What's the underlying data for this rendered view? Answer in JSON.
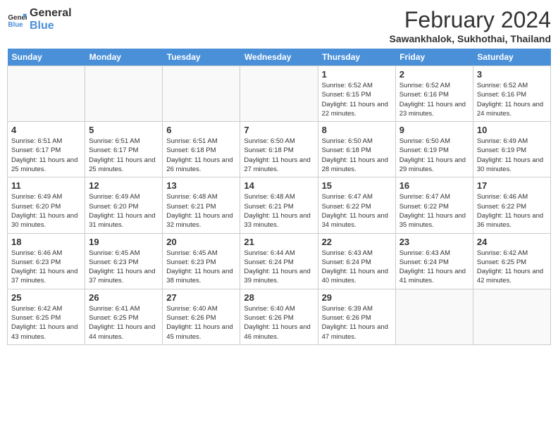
{
  "header": {
    "logo_line1": "General",
    "logo_line2": "Blue",
    "month_year": "February 2024",
    "location": "Sawankhalok, Sukhothai, Thailand"
  },
  "weekdays": [
    "Sunday",
    "Monday",
    "Tuesday",
    "Wednesday",
    "Thursday",
    "Friday",
    "Saturday"
  ],
  "weeks": [
    [
      {
        "day": "",
        "info": ""
      },
      {
        "day": "",
        "info": ""
      },
      {
        "day": "",
        "info": ""
      },
      {
        "day": "",
        "info": ""
      },
      {
        "day": "1",
        "info": "Sunrise: 6:52 AM\nSunset: 6:15 PM\nDaylight: 11 hours and 22 minutes."
      },
      {
        "day": "2",
        "info": "Sunrise: 6:52 AM\nSunset: 6:16 PM\nDaylight: 11 hours and 23 minutes."
      },
      {
        "day": "3",
        "info": "Sunrise: 6:52 AM\nSunset: 6:16 PM\nDaylight: 11 hours and 24 minutes."
      }
    ],
    [
      {
        "day": "4",
        "info": "Sunrise: 6:51 AM\nSunset: 6:17 PM\nDaylight: 11 hours and 25 minutes."
      },
      {
        "day": "5",
        "info": "Sunrise: 6:51 AM\nSunset: 6:17 PM\nDaylight: 11 hours and 25 minutes."
      },
      {
        "day": "6",
        "info": "Sunrise: 6:51 AM\nSunset: 6:18 PM\nDaylight: 11 hours and 26 minutes."
      },
      {
        "day": "7",
        "info": "Sunrise: 6:50 AM\nSunset: 6:18 PM\nDaylight: 11 hours and 27 minutes."
      },
      {
        "day": "8",
        "info": "Sunrise: 6:50 AM\nSunset: 6:18 PM\nDaylight: 11 hours and 28 minutes."
      },
      {
        "day": "9",
        "info": "Sunrise: 6:50 AM\nSunset: 6:19 PM\nDaylight: 11 hours and 29 minutes."
      },
      {
        "day": "10",
        "info": "Sunrise: 6:49 AM\nSunset: 6:19 PM\nDaylight: 11 hours and 30 minutes."
      }
    ],
    [
      {
        "day": "11",
        "info": "Sunrise: 6:49 AM\nSunset: 6:20 PM\nDaylight: 11 hours and 30 minutes."
      },
      {
        "day": "12",
        "info": "Sunrise: 6:49 AM\nSunset: 6:20 PM\nDaylight: 11 hours and 31 minutes."
      },
      {
        "day": "13",
        "info": "Sunrise: 6:48 AM\nSunset: 6:21 PM\nDaylight: 11 hours and 32 minutes."
      },
      {
        "day": "14",
        "info": "Sunrise: 6:48 AM\nSunset: 6:21 PM\nDaylight: 11 hours and 33 minutes."
      },
      {
        "day": "15",
        "info": "Sunrise: 6:47 AM\nSunset: 6:22 PM\nDaylight: 11 hours and 34 minutes."
      },
      {
        "day": "16",
        "info": "Sunrise: 6:47 AM\nSunset: 6:22 PM\nDaylight: 11 hours and 35 minutes."
      },
      {
        "day": "17",
        "info": "Sunrise: 6:46 AM\nSunset: 6:22 PM\nDaylight: 11 hours and 36 minutes."
      }
    ],
    [
      {
        "day": "18",
        "info": "Sunrise: 6:46 AM\nSunset: 6:23 PM\nDaylight: 11 hours and 37 minutes."
      },
      {
        "day": "19",
        "info": "Sunrise: 6:45 AM\nSunset: 6:23 PM\nDaylight: 11 hours and 37 minutes."
      },
      {
        "day": "20",
        "info": "Sunrise: 6:45 AM\nSunset: 6:23 PM\nDaylight: 11 hours and 38 minutes."
      },
      {
        "day": "21",
        "info": "Sunrise: 6:44 AM\nSunset: 6:24 PM\nDaylight: 11 hours and 39 minutes."
      },
      {
        "day": "22",
        "info": "Sunrise: 6:43 AM\nSunset: 6:24 PM\nDaylight: 11 hours and 40 minutes."
      },
      {
        "day": "23",
        "info": "Sunrise: 6:43 AM\nSunset: 6:24 PM\nDaylight: 11 hours and 41 minutes."
      },
      {
        "day": "24",
        "info": "Sunrise: 6:42 AM\nSunset: 6:25 PM\nDaylight: 11 hours and 42 minutes."
      }
    ],
    [
      {
        "day": "25",
        "info": "Sunrise: 6:42 AM\nSunset: 6:25 PM\nDaylight: 11 hours and 43 minutes."
      },
      {
        "day": "26",
        "info": "Sunrise: 6:41 AM\nSunset: 6:25 PM\nDaylight: 11 hours and 44 minutes."
      },
      {
        "day": "27",
        "info": "Sunrise: 6:40 AM\nSunset: 6:26 PM\nDaylight: 11 hours and 45 minutes."
      },
      {
        "day": "28",
        "info": "Sunrise: 6:40 AM\nSunset: 6:26 PM\nDaylight: 11 hours and 46 minutes."
      },
      {
        "day": "29",
        "info": "Sunrise: 6:39 AM\nSunset: 6:26 PM\nDaylight: 11 hours and 47 minutes."
      },
      {
        "day": "",
        "info": ""
      },
      {
        "day": "",
        "info": ""
      }
    ]
  ]
}
